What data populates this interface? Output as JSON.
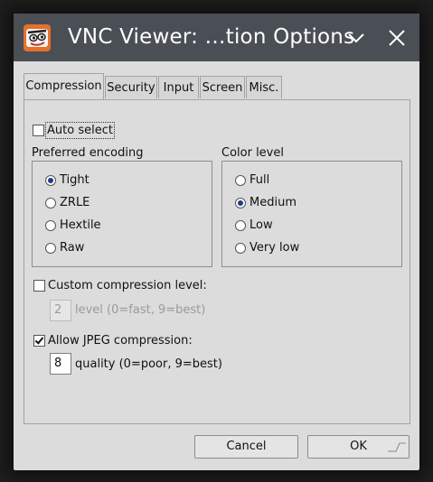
{
  "window": {
    "title": "VNC Viewer: ...tion Options",
    "title_display": "VNC Viewer: …tion Options"
  },
  "titlebar": {
    "app_icon": "vnc-viewer-icon",
    "minimize_icon": "chevron-down-icon",
    "close_icon": "close-icon"
  },
  "tabs": [
    {
      "label": "Compression",
      "active": true
    },
    {
      "label": "Security",
      "active": false
    },
    {
      "label": "Input",
      "active": false
    },
    {
      "label": "Screen",
      "active": false
    },
    {
      "label": "Misc.",
      "active": false
    }
  ],
  "compression": {
    "auto_select": {
      "label": "Auto select",
      "checked": false
    },
    "preferred_encoding": {
      "label": "Preferred encoding",
      "options": [
        {
          "label": "Tight",
          "checked": true
        },
        {
          "label": "ZRLE",
          "checked": false
        },
        {
          "label": "Hextile",
          "checked": false
        },
        {
          "label": "Raw",
          "checked": false
        }
      ]
    },
    "color_level": {
      "label": "Color level",
      "options": [
        {
          "label": "Full",
          "checked": false
        },
        {
          "label": "Medium",
          "checked": true
        },
        {
          "label": "Low",
          "checked": false
        },
        {
          "label": "Very low",
          "checked": false
        }
      ]
    },
    "custom_compression": {
      "label": "Custom compression level:",
      "checked": false,
      "value": "2",
      "hint": "level (0=fast, 9=best)"
    },
    "jpeg": {
      "label": "Allow JPEG compression:",
      "checked": true,
      "value": "8",
      "hint": "quality (0=poor, 9=best)"
    }
  },
  "buttons": {
    "cancel": "Cancel",
    "ok": "OK"
  }
}
